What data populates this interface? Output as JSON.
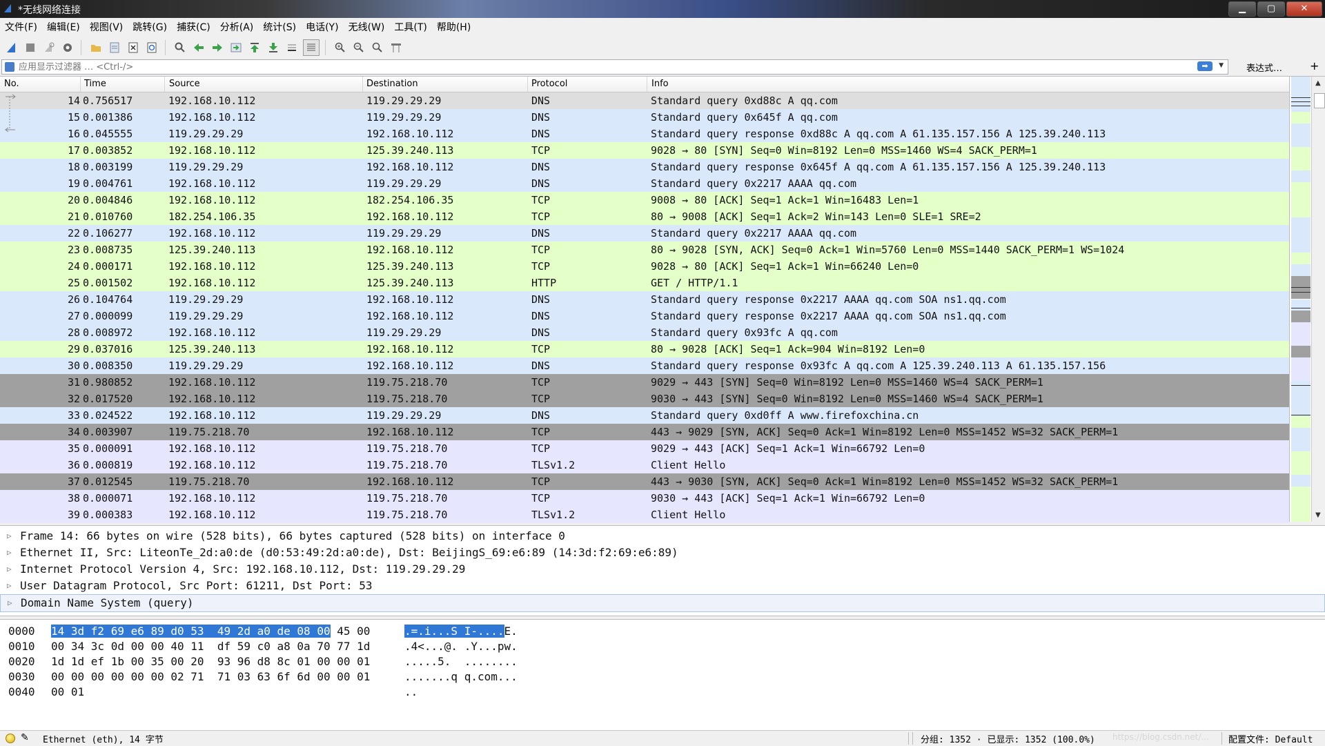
{
  "window": {
    "title": "*无线网络连接",
    "minimize": "▁",
    "maximize": "▢",
    "close": "✕"
  },
  "menu": [
    "文件(F)",
    "编辑(E)",
    "视图(V)",
    "跳转(G)",
    "捕获(C)",
    "分析(A)",
    "统计(S)",
    "电话(Y)",
    "无线(W)",
    "工具(T)",
    "帮助(H)"
  ],
  "toolbar_icons": [
    "shark-fin-start-icon",
    "stop-icon",
    "restart-icon",
    "options-gear-icon",
    "open-folder-icon",
    "save-file-icon",
    "close-file-icon",
    "reload-icon",
    "find-icon",
    "go-back-icon",
    "go-forward-icon",
    "go-to-packet-icon",
    "go-first-icon",
    "go-last-icon",
    "autoscroll-icon",
    "colorize-icon",
    "zoom-in-icon",
    "zoom-out-icon",
    "zoom-normal-icon",
    "resize-columns-icon"
  ],
  "filter": {
    "placeholder": "应用显示过滤器 … <Ctrl-/>",
    "expression_label": "表达式…",
    "plus": "+"
  },
  "columns": {
    "no": "No.",
    "time": "Time",
    "source": "Source",
    "destination": "Destination",
    "protocol": "Protocol",
    "info": "Info"
  },
  "colors": {
    "dns": "#dae8fc",
    "tcp": "#e4ffc7",
    "http": "#e4ffc7",
    "syn": "#a0a0a0",
    "tls": "#e7e6ff",
    "selected": "#dedede"
  },
  "packets": [
    {
      "no": "14",
      "time": "0.756517",
      "src": "192.168.10.112",
      "dst": "119.29.29.29",
      "proto": "DNS",
      "info": "Standard query 0xd88c A qq.com",
      "color": "selected"
    },
    {
      "no": "15",
      "time": "0.001386",
      "src": "192.168.10.112",
      "dst": "119.29.29.29",
      "proto": "DNS",
      "info": "Standard query 0x645f A qq.com",
      "color": "dns"
    },
    {
      "no": "16",
      "time": "0.045555",
      "src": "119.29.29.29",
      "dst": "192.168.10.112",
      "proto": "DNS",
      "info": "Standard query response 0xd88c A qq.com A 61.135.157.156 A 125.39.240.113",
      "color": "dns"
    },
    {
      "no": "17",
      "time": "0.003852",
      "src": "192.168.10.112",
      "dst": "125.39.240.113",
      "proto": "TCP",
      "info": "9028 → 80 [SYN] Seq=0 Win=8192 Len=0 MSS=1460 WS=4 SACK_PERM=1",
      "color": "tcp"
    },
    {
      "no": "18",
      "time": "0.003199",
      "src": "119.29.29.29",
      "dst": "192.168.10.112",
      "proto": "DNS",
      "info": "Standard query response 0x645f A qq.com A 61.135.157.156 A 125.39.240.113",
      "color": "dns"
    },
    {
      "no": "19",
      "time": "0.004761",
      "src": "192.168.10.112",
      "dst": "119.29.29.29",
      "proto": "DNS",
      "info": "Standard query 0x2217 AAAA qq.com",
      "color": "dns"
    },
    {
      "no": "20",
      "time": "0.004846",
      "src": "192.168.10.112",
      "dst": "182.254.106.35",
      "proto": "TCP",
      "info": "9008 → 80 [ACK] Seq=1 Ack=1 Win=16483 Len=1",
      "color": "tcp"
    },
    {
      "no": "21",
      "time": "0.010760",
      "src": "182.254.106.35",
      "dst": "192.168.10.112",
      "proto": "TCP",
      "info": "80 → 9008 [ACK] Seq=1 Ack=2 Win=143 Len=0 SLE=1 SRE=2",
      "color": "tcp"
    },
    {
      "no": "22",
      "time": "0.106277",
      "src": "192.168.10.112",
      "dst": "119.29.29.29",
      "proto": "DNS",
      "info": "Standard query 0x2217 AAAA qq.com",
      "color": "dns"
    },
    {
      "no": "23",
      "time": "0.008735",
      "src": "125.39.240.113",
      "dst": "192.168.10.112",
      "proto": "TCP",
      "info": "80 → 9028 [SYN, ACK] Seq=0 Ack=1 Win=5760 Len=0 MSS=1440 SACK_PERM=1 WS=1024",
      "color": "tcp"
    },
    {
      "no": "24",
      "time": "0.000171",
      "src": "192.168.10.112",
      "dst": "125.39.240.113",
      "proto": "TCP",
      "info": "9028 → 80 [ACK] Seq=1 Ack=1 Win=66240 Len=0",
      "color": "tcp"
    },
    {
      "no": "25",
      "time": "0.001502",
      "src": "192.168.10.112",
      "dst": "125.39.240.113",
      "proto": "HTTP",
      "info": "GET / HTTP/1.1",
      "color": "http"
    },
    {
      "no": "26",
      "time": "0.104764",
      "src": "119.29.29.29",
      "dst": "192.168.10.112",
      "proto": "DNS",
      "info": "Standard query response 0x2217 AAAA qq.com SOA ns1.qq.com",
      "color": "dns"
    },
    {
      "no": "27",
      "time": "0.000099",
      "src": "119.29.29.29",
      "dst": "192.168.10.112",
      "proto": "DNS",
      "info": "Standard query response 0x2217 AAAA qq.com SOA ns1.qq.com",
      "color": "dns"
    },
    {
      "no": "28",
      "time": "0.008972",
      "src": "192.168.10.112",
      "dst": "119.29.29.29",
      "proto": "DNS",
      "info": "Standard query 0x93fc A qq.com",
      "color": "dns"
    },
    {
      "no": "29",
      "time": "0.037016",
      "src": "125.39.240.113",
      "dst": "192.168.10.112",
      "proto": "TCP",
      "info": "80 → 9028 [ACK] Seq=1 Ack=904 Win=8192 Len=0",
      "color": "tcp"
    },
    {
      "no": "30",
      "time": "0.008350",
      "src": "119.29.29.29",
      "dst": "192.168.10.112",
      "proto": "DNS",
      "info": "Standard query response 0x93fc A qq.com A 125.39.240.113 A 61.135.157.156",
      "color": "dns"
    },
    {
      "no": "31",
      "time": "0.980852",
      "src": "192.168.10.112",
      "dst": "119.75.218.70",
      "proto": "TCP",
      "info": "9029 → 443 [SYN] Seq=0 Win=8192 Len=0 MSS=1460 WS=4 SACK_PERM=1",
      "color": "syn"
    },
    {
      "no": "32",
      "time": "0.017520",
      "src": "192.168.10.112",
      "dst": "119.75.218.70",
      "proto": "TCP",
      "info": "9030 → 443 [SYN] Seq=0 Win=8192 Len=0 MSS=1460 WS=4 SACK_PERM=1",
      "color": "syn"
    },
    {
      "no": "33",
      "time": "0.024522",
      "src": "192.168.10.112",
      "dst": "119.29.29.29",
      "proto": "DNS",
      "info": "Standard query 0xd0ff A www.firefoxchina.cn",
      "color": "dns"
    },
    {
      "no": "34",
      "time": "0.003907",
      "src": "119.75.218.70",
      "dst": "192.168.10.112",
      "proto": "TCP",
      "info": "443 → 9029 [SYN, ACK] Seq=0 Ack=1 Win=8192 Len=0 MSS=1452 WS=32 SACK_PERM=1",
      "color": "syn"
    },
    {
      "no": "35",
      "time": "0.000091",
      "src": "192.168.10.112",
      "dst": "119.75.218.70",
      "proto": "TCP",
      "info": "9029 → 443 [ACK] Seq=1 Ack=1 Win=66792 Len=0",
      "color": "tls"
    },
    {
      "no": "36",
      "time": "0.000819",
      "src": "192.168.10.112",
      "dst": "119.75.218.70",
      "proto": "TLSv1.2",
      "info": "Client Hello",
      "color": "tls"
    },
    {
      "no": "37",
      "time": "0.012545",
      "src": "119.75.218.70",
      "dst": "192.168.10.112",
      "proto": "TCP",
      "info": "443 → 9030 [SYN, ACK] Seq=0 Ack=1 Win=8192 Len=0 MSS=1452 WS=32 SACK_PERM=1",
      "color": "syn"
    },
    {
      "no": "38",
      "time": "0.000071",
      "src": "192.168.10.112",
      "dst": "119.75.218.70",
      "proto": "TCP",
      "info": "9030 → 443 [ACK] Seq=1 Ack=1 Win=66792 Len=0",
      "color": "tls"
    },
    {
      "no": "39",
      "time": "0.000383",
      "src": "192.168.10.112",
      "dst": "119.75.218.70",
      "proto": "TLSv1.2",
      "info": "Client Hello",
      "color": "tls"
    }
  ],
  "details": [
    "Frame 14: 66 bytes on wire (528 bits), 66 bytes captured (528 bits) on interface 0",
    "Ethernet II, Src: LiteonTe_2d:a0:de (d0:53:49:2d:a0:de), Dst: BeijingS_69:e6:89 (14:3d:f2:69:e6:89)",
    "Internet Protocol Version 4, Src: 192.168.10.112, Dst: 119.29.29.29",
    "User Datagram Protocol, Src Port: 61211, Dst Port: 53",
    "Domain Name System (query)"
  ],
  "bytes": [
    {
      "off": "0000",
      "hex_hl": "14 3d f2 69 e6 89 d0 53  49 2d a0 de 08 00",
      "hex_rest": " 45 00",
      "asc_hl": ".=.i...S I-....",
      "asc_rest": "E."
    },
    {
      "off": "0010",
      "hex_hl": "",
      "hex_rest": "00 34 3c 0d 00 00 40 11  df 59 c0 a8 0a 70 77 1d",
      "asc_hl": "",
      "asc_rest": ".4<...@. .Y...pw."
    },
    {
      "off": "0020",
      "hex_hl": "",
      "hex_rest": "1d 1d ef 1b 00 35 00 20  93 96 d8 8c 01 00 00 01",
      "asc_hl": "",
      "asc_rest": ".....5.  ........"
    },
    {
      "off": "0030",
      "hex_hl": "",
      "hex_rest": "00 00 00 00 00 00 02 71  71 03 63 6f 6d 00 00 01",
      "asc_hl": "",
      "asc_rest": ".......q q.com..."
    },
    {
      "off": "0040",
      "hex_hl": "",
      "hex_rest": "00 01",
      "asc_hl": "",
      "asc_rest": ".."
    }
  ],
  "status": {
    "left": "Ethernet (eth), 14 字节",
    "packets": "分组: 1352 · 已显示: 1352 (100.0%)",
    "watermark": "https://blog.csdn.net/...",
    "profile": "配置文件: Default"
  }
}
